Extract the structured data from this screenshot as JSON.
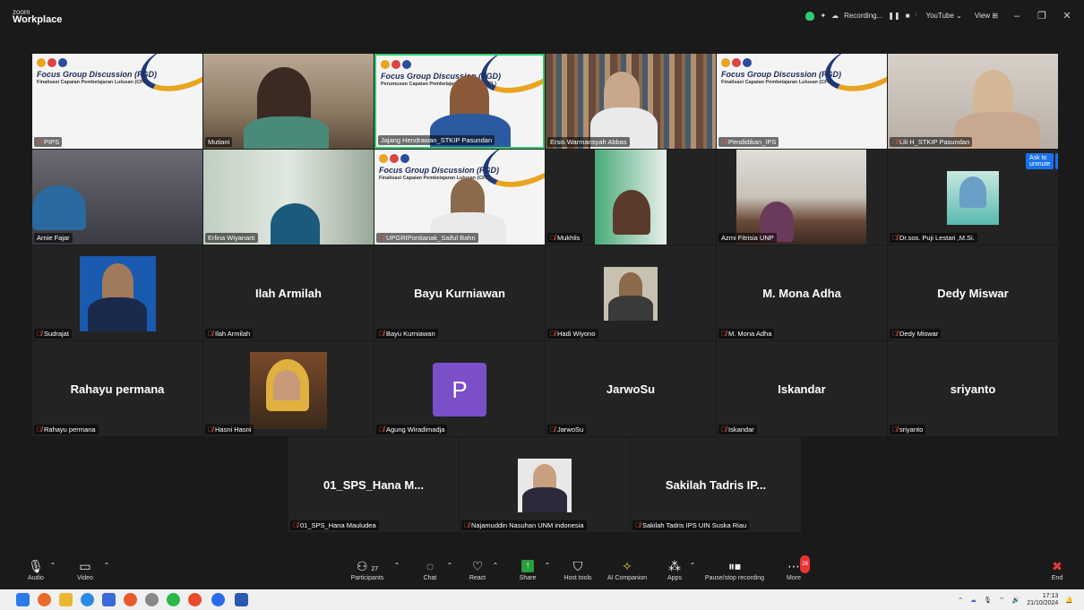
{
  "window": {
    "logo_line1": "zoom",
    "logo_line2": "Workplace",
    "recording_label": "Recording...",
    "youtube_label": "YouTube ⌄",
    "view_label": "View ⊞"
  },
  "slide": {
    "title": "Focus Group Discussion (FGD)",
    "subtitle_a": "Finalisasi Capaian Pembelajaran Lulusan (CPL)",
    "subtitle_b": "Perumusan Capaian Pembelajaran Lulusan (CPL)"
  },
  "participants": {
    "p1": "PIPS",
    "p2": "Mutiani",
    "p3": "Jajang Hendrawan_STKIP Pasundan",
    "p4": "Ersis Warmansyah Abbas",
    "p5": "Pendidikan_IPS",
    "p6": "Lili H_STKIP Pasundan",
    "p7": "Arnie Fajar",
    "p8": "Erlina Wiyanarti",
    "p9": "UPGRIPontianak_Saiful Bahri",
    "p10": "Mukhlis",
    "p11": "Azmi Fitrisia UNP",
    "p12": "Dr.sos. Puji Lestari ,M.Si.",
    "p13": "Sudrajat",
    "p14": "Ilah Armilah",
    "p15": "Bayu Kurniawan",
    "p16": "Hadi Wiyono",
    "p17": "M. Mona Adha",
    "p18": "Dedy Miswar",
    "p19": "Rahayu permana",
    "p20": "Hasni Hasni",
    "p21": "Agung Wiradimadja",
    "p22": "JarwoSu",
    "p23": "Iskandar",
    "p24": "sriyanto",
    "p25": "01_SPS_Hana Mauludea",
    "p26": "Najamuddin Nasuhan UNM indonesia",
    "p27": "Sakilah Tadris IPS UIN Suska Riau"
  },
  "bignames": {
    "p14": "Ilah Armilah",
    "p15": "Bayu Kurniawan",
    "p17": "M. Mona Adha",
    "p18": "Dedy Miswar",
    "p19": "Rahayu permana",
    "p22": "JarwoSu",
    "p23": "Iskandar",
    "p24": "sriyanto",
    "p25": "01_SPS_Hana  M...",
    "p27": "Sakilah Tadris IP..."
  },
  "avatar_letter": "P",
  "ask_to_unmute": "Ask to unmute",
  "more_dots": "···",
  "toolbar": {
    "audio": "Audio",
    "video": "Video",
    "participants": "Participants",
    "participants_count": "27",
    "chat": "Chat",
    "react": "React",
    "share": "Share",
    "host_tools": "Host tools",
    "ai_companion": "AI Companion",
    "apps": "Apps",
    "pause_recording": "Pause/stop recording",
    "more": "More",
    "more_badge": "26",
    "end": "End"
  },
  "taskbar": {
    "time": "17:13",
    "date": "21/10/2024"
  },
  "colors": {
    "accent_blue": "#1a73e8",
    "active_speaker": "#2ecc71",
    "avatar_purple": "#7b4fc9",
    "end_red": "#e33b3b"
  }
}
